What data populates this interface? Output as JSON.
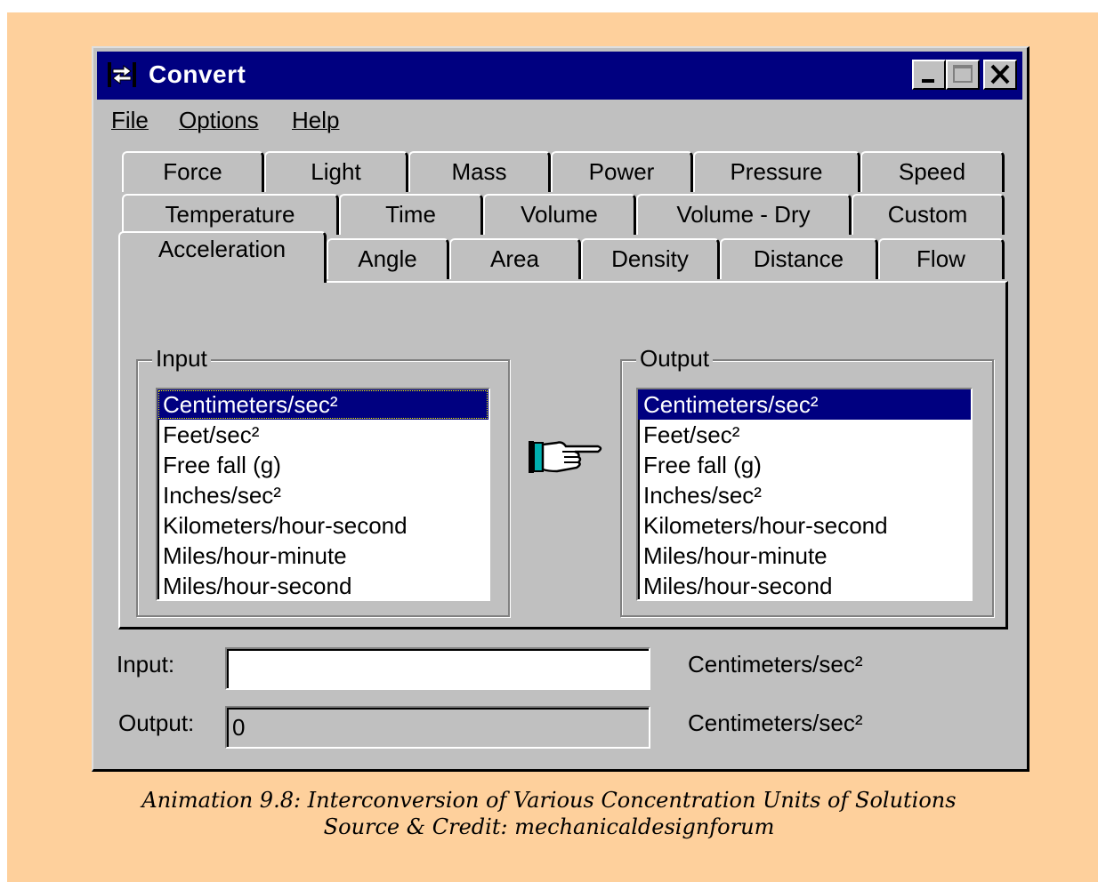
{
  "window": {
    "title": "Convert",
    "controls": {
      "minimize": "minimize-icon",
      "maximize": "maximize-icon",
      "close": "close-icon"
    }
  },
  "menu": [
    "File",
    "Options",
    "Help"
  ],
  "tabs": {
    "row1": [
      "Force",
      "Light",
      "Mass",
      "Power",
      "Pressure",
      "Speed"
    ],
    "row2": [
      "Temperature",
      "Time",
      "Volume",
      "Volume - Dry",
      "Custom"
    ],
    "row3": [
      "Acceleration",
      "Angle",
      "Area",
      "Density",
      "Distance",
      "Flow"
    ],
    "active": "Acceleration"
  },
  "input_group": {
    "label": "Input",
    "items": [
      "Centimeters/sec²",
      "Feet/sec²",
      "Free fall (g)",
      "Inches/sec²",
      "Kilometers/hour-second",
      "Miles/hour-minute",
      "Miles/hour-second"
    ],
    "selected": "Centimeters/sec²"
  },
  "output_group": {
    "label": "Output",
    "items": [
      "Centimeters/sec²",
      "Feet/sec²",
      "Free fall (g)",
      "Inches/sec²",
      "Kilometers/hour-second",
      "Miles/hour-minute",
      "Miles/hour-second"
    ],
    "selected": "Centimeters/sec²"
  },
  "fields": {
    "input_label": "Input:",
    "input_value": "",
    "input_unit": "Centimeters/sec²",
    "output_label": "Output:",
    "output_value": "0",
    "output_unit": "Centimeters/sec²"
  },
  "caption": {
    "line1": "Animation 9.8: Interconversion of Various Concentration Units of Solutions",
    "line2": "Source & Credit: mechanicaldesignforum"
  },
  "colors": {
    "page_background": "#fed09c",
    "titlebar": "#000080",
    "window": "#c0c0c0",
    "selection": "#000080"
  },
  "icons": {
    "app": "convert-app-icon",
    "pointer": "pointing-hand-icon"
  }
}
